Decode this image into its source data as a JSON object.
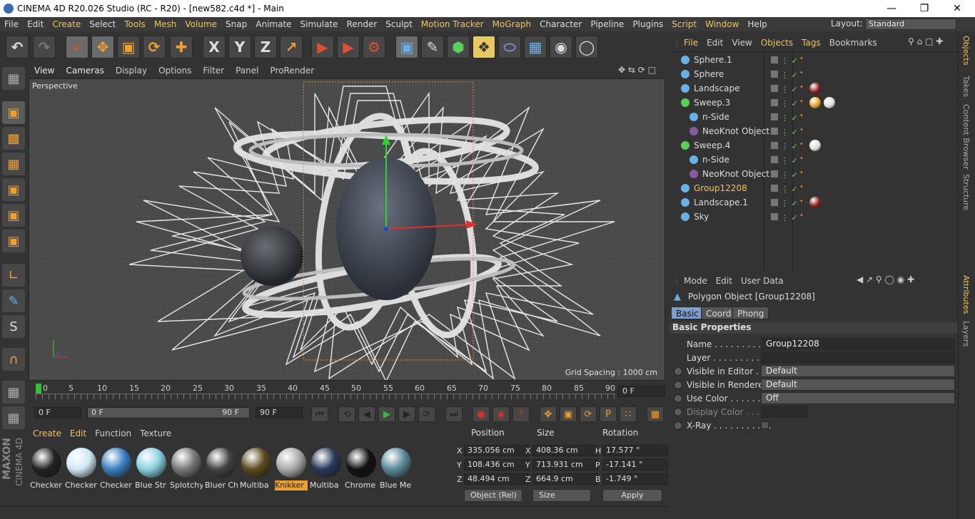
{
  "window": {
    "title": "CINEMA 4D R20.026 Studio (RC - R20) - [new582.c4d *] - Main"
  },
  "menubar": {
    "items": [
      "File",
      "Edit",
      "Create",
      "Select",
      "Tools",
      "Mesh",
      "Volume",
      "Snap",
      "Animate",
      "Simulate",
      "Render",
      "Sculpt",
      "Motion Tracker",
      "MoGraph",
      "Character",
      "Pipeline",
      "Plugins",
      "Script",
      "Window",
      "Help"
    ],
    "layout_label": "Layout:",
    "layout_value": "Standard"
  },
  "toolbar": {
    "icons": [
      "undo-icon",
      "redo-icon",
      "select-icon",
      "move-icon",
      "scale-icon",
      "rotate-icon",
      "add-icon",
      "x-axis-icon",
      "y-axis-icon",
      "z-axis-icon",
      "coord-system-icon",
      "render-view-icon",
      "render-picture-icon",
      "edit-render-settings-icon",
      "cube-icon",
      "pen-icon",
      "subdivision-icon",
      "array-icon",
      "deformer-icon",
      "floor-icon",
      "camera-icon",
      "light-icon"
    ]
  },
  "viewport": {
    "menu": [
      "View",
      "Cameras",
      "Display",
      "Options",
      "Filter",
      "Panel",
      "ProRender"
    ],
    "label": "Perspective",
    "grid_spacing": "Grid Spacing : 1000 cm"
  },
  "timeline": {
    "ticks": [
      "0",
      "5",
      "10",
      "15",
      "20",
      "25",
      "30",
      "35",
      "40",
      "45",
      "50",
      "55",
      "60",
      "65",
      "70",
      "75",
      "80",
      "85",
      "90"
    ],
    "current_frame": "0 F"
  },
  "playbar": {
    "start": "0 F",
    "range_start": "0 F",
    "range_end": "90 F",
    "end": "90 F"
  },
  "materials": {
    "menu": [
      "Create",
      "Edit",
      "Function",
      "Texture"
    ],
    "items": [
      {
        "label": "Checker",
        "color": "#222222",
        "active": false
      },
      {
        "label": "Checker",
        "color": "#cfe8f5",
        "active": false
      },
      {
        "label": "Checker",
        "color": "#3a7fc0",
        "active": false
      },
      {
        "label": "Blue Str",
        "color": "#8ad0e0",
        "active": false
      },
      {
        "label": "Splotchy",
        "color": "#777777",
        "active": false
      },
      {
        "label": "Bluer Ch",
        "color": "#444444",
        "active": false
      },
      {
        "label": "Multiba",
        "color": "#5a4a20",
        "active": false
      },
      {
        "label": "Knikker",
        "color": "#aaaaaa",
        "active": true
      },
      {
        "label": "Multiba",
        "color": "#2a3a5a",
        "active": false
      },
      {
        "label": "Chrome",
        "color": "#111111",
        "active": false
      },
      {
        "label": "Blue Me",
        "color": "#5a8a98",
        "active": false
      }
    ]
  },
  "coordinates": {
    "headers": [
      "Position",
      "Size",
      "Rotation"
    ],
    "rows": [
      {
        "axis": "X",
        "pos": "335.056 cm",
        "size_axis": "X",
        "size": "408.36 cm",
        "rot_axis": "H",
        "rot": "17.577 °"
      },
      {
        "axis": "Y",
        "pos": "108.436 cm",
        "size_axis": "Y",
        "size": "713.931 cm",
        "rot_axis": "P",
        "rot": "-17.141 °"
      },
      {
        "axis": "Z",
        "pos": "48.494 cm",
        "size_axis": "Z",
        "size": "664.9 cm",
        "rot_axis": "B",
        "rot": "-1.749 °"
      }
    ],
    "mode": "Object (Rel)",
    "size_mode": "Size",
    "apply": "Apply"
  },
  "objects": {
    "menu": [
      "File",
      "Edit",
      "View",
      "Objects",
      "Tags",
      "Bookmarks"
    ],
    "rows": [
      {
        "name": "Sphere.1",
        "indent": 0,
        "icon": "#6ab0e8",
        "selected": false,
        "tags": []
      },
      {
        "name": "Sphere",
        "indent": 0,
        "icon": "#6ab0e8",
        "selected": false,
        "tags": []
      },
      {
        "name": "Landscape",
        "indent": 0,
        "icon": "#6ab0e8",
        "selected": false,
        "tags": [
          "#8a1a1a"
        ]
      },
      {
        "name": "Sweep.3",
        "indent": 0,
        "icon": "#5ad05a",
        "selected": false,
        "tags": [
          "#e0a020",
          "#dcdcdc"
        ]
      },
      {
        "name": "n-Side",
        "indent": 1,
        "icon": "#6ab0e8",
        "selected": false,
        "tags": []
      },
      {
        "name": "NeoKnot Object",
        "indent": 1,
        "icon": "#8a5aa0",
        "selected": false,
        "tags": []
      },
      {
        "name": "Sweep.4",
        "indent": 0,
        "icon": "#5ad05a",
        "selected": false,
        "tags": [
          "#dcdcdc"
        ]
      },
      {
        "name": "n-Side",
        "indent": 1,
        "icon": "#6ab0e8",
        "selected": false,
        "tags": []
      },
      {
        "name": "NeoKnot Object",
        "indent": 1,
        "icon": "#8a5aa0",
        "selected": false,
        "tags": []
      },
      {
        "name": "Group12208",
        "indent": 0,
        "icon": "#6ab0e8",
        "selected": true,
        "tags": []
      },
      {
        "name": "Landscape.1",
        "indent": 0,
        "icon": "#6ab0e8",
        "selected": false,
        "tags": [
          "#8a1a1a"
        ]
      },
      {
        "name": "Sky",
        "indent": 0,
        "icon": "#6ab0e8",
        "selected": false,
        "tags": []
      }
    ]
  },
  "attributes": {
    "menu": [
      "Mode",
      "Edit",
      "User Data"
    ],
    "title": "Polygon Object [Group12208]",
    "tabs": [
      "Basic",
      "Coord.",
      "Phong"
    ],
    "section": "Basic Properties",
    "fields": [
      {
        "label": "Name . . . . . . . . . . . .",
        "value": "Group12208",
        "kind": "text",
        "radio": false,
        "dim": false
      },
      {
        "label": "Layer . . . . . . . . . . . .",
        "value": "",
        "kind": "text",
        "radio": false,
        "dim": false
      },
      {
        "label": "Visible in Editor . . .",
        "value": "Default",
        "kind": "select",
        "radio": true,
        "dim": false
      },
      {
        "label": "Visible in Renderer",
        "value": "Default",
        "kind": "select",
        "radio": true,
        "dim": false
      },
      {
        "label": "Use Color . . . . . . . .",
        "value": "Off",
        "kind": "select",
        "radio": true,
        "dim": false
      },
      {
        "label": "Display Color . . .",
        "value": "",
        "kind": "color",
        "radio": true,
        "dim": true
      },
      {
        "label": "X-Ray . . . . . . . . . . .",
        "value": "",
        "kind": "check",
        "radio": true,
        "dim": false
      }
    ]
  },
  "side_tabs": {
    "top": [
      "Objects",
      "Takes",
      "Content Browser",
      "Structure"
    ],
    "bottom": [
      "Attributes",
      "Layers"
    ]
  },
  "logo": {
    "text1": "MAXON",
    "text2": "CINEMA 4D"
  }
}
